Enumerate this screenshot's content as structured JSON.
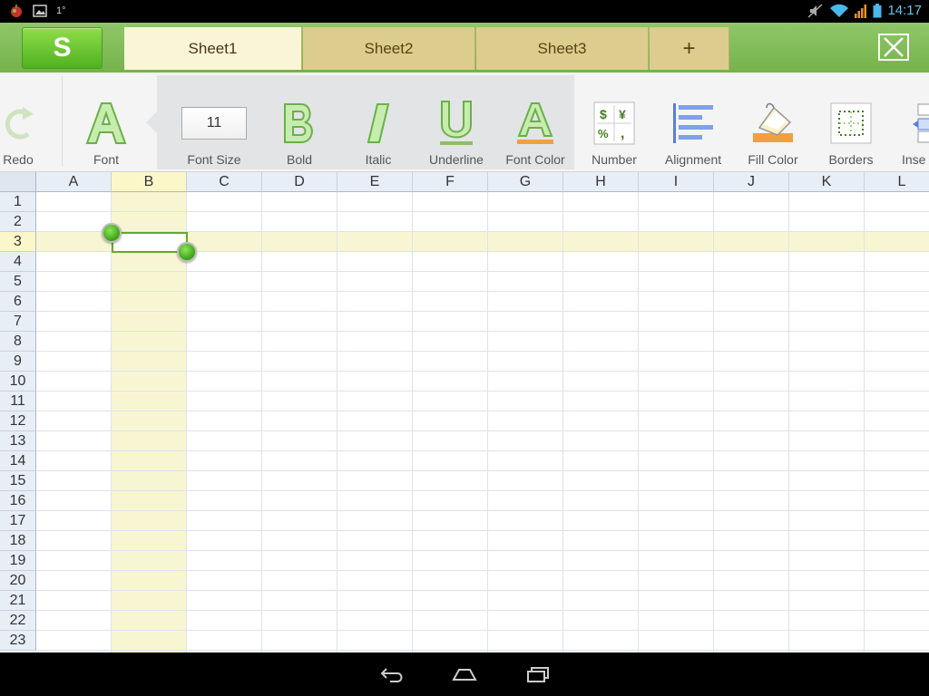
{
  "status_bar": {
    "notification_text": "1°",
    "time": "14:17"
  },
  "tabs": {
    "logo": "S",
    "items": [
      "Sheet1",
      "Sheet2",
      "Sheet3"
    ],
    "active_index": 0,
    "add_label": "+"
  },
  "toolbar": {
    "redo": "Redo",
    "font": "Font",
    "font_size_label": "Font Size",
    "font_size_value": "11",
    "bold": "Bold",
    "italic": "Italic",
    "underline": "Underline",
    "font_color": "Font Color",
    "number": "Number",
    "alignment": "Alignment",
    "fill_color": "Fill Color",
    "borders": "Borders",
    "insert_partial": "Inse"
  },
  "grid": {
    "columns": [
      "A",
      "B",
      "C",
      "D",
      "E",
      "F",
      "G",
      "H",
      "I",
      "J",
      "K",
      "L"
    ],
    "rows": [
      "1",
      "2",
      "3",
      "4",
      "5",
      "6",
      "7",
      "8",
      "9",
      "10",
      "11",
      "12",
      "13",
      "14",
      "15",
      "16",
      "17",
      "18",
      "19",
      "20",
      "21",
      "22",
      "23"
    ],
    "selected_column": "B",
    "selected_row": "3"
  },
  "colors": {
    "accent_green": "#75b34a",
    "selection_highlight": "#f8f6d2",
    "active_tab": "#fbf5d8"
  }
}
